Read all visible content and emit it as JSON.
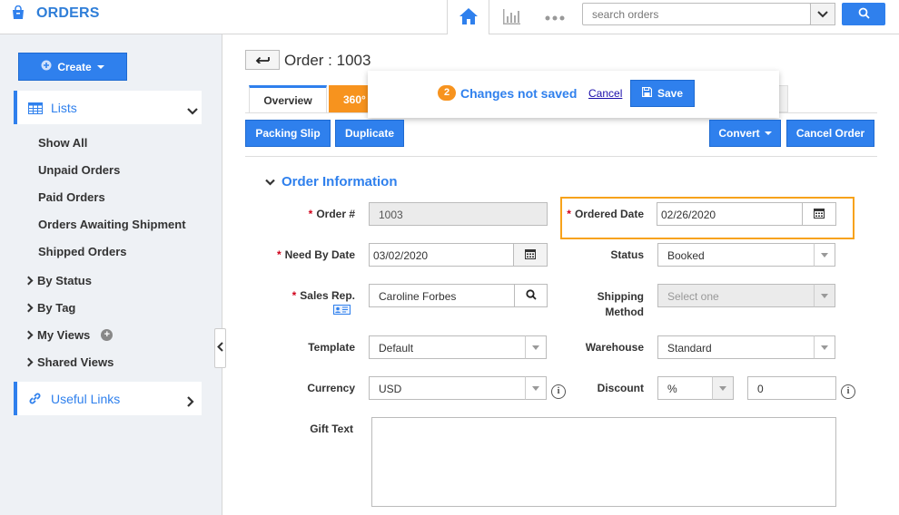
{
  "app": {
    "title": "ORDERS"
  },
  "topbar": {
    "search_placeholder": "search orders"
  },
  "sidebar": {
    "create_label": "Create",
    "lists_label": "Lists",
    "links": [
      "Show All",
      "Unpaid Orders",
      "Paid Orders",
      "Orders Awaiting Shipment",
      "Shipped Orders"
    ],
    "groups": [
      "By Status",
      "By Tag",
      "My Views",
      "Shared Views"
    ],
    "useful_links_label": "Useful Links"
  },
  "order": {
    "title": "Order : 1003",
    "tabs": {
      "overview": "Overview",
      "t360": "360°"
    },
    "unsaved": {
      "count": "2",
      "text": "Changes not saved",
      "cancel": "Cancel",
      "save": "Save"
    },
    "actions": {
      "packing_slip": "Packing Slip",
      "duplicate": "Duplicate",
      "convert": "Convert",
      "cancel_order": "Cancel Order"
    },
    "section_title": "Order Information",
    "fields": {
      "order_no": {
        "label": "Order #",
        "value": "1003"
      },
      "ordered_date": {
        "label": "Ordered Date",
        "value": "02/26/2020"
      },
      "need_by_date": {
        "label": "Need By Date",
        "value": "03/02/2020"
      },
      "status": {
        "label": "Status",
        "value": "Booked"
      },
      "sales_rep": {
        "label": "Sales Rep.",
        "value": "Caroline Forbes"
      },
      "shipping_method": {
        "label_line1": "Shipping",
        "label_line2": "Method",
        "value": "Select one"
      },
      "template": {
        "label": "Template",
        "value": "Default"
      },
      "warehouse": {
        "label": "Warehouse",
        "value": "Standard"
      },
      "currency": {
        "label": "Currency",
        "value": "USD"
      },
      "discount": {
        "label": "Discount",
        "type": "%",
        "value": "0"
      },
      "gift_text": {
        "label": "Gift Text",
        "value": ""
      }
    }
  },
  "colors": {
    "accent": "#2f80ed",
    "orange": "#f7931e",
    "required": "#d0021b"
  }
}
